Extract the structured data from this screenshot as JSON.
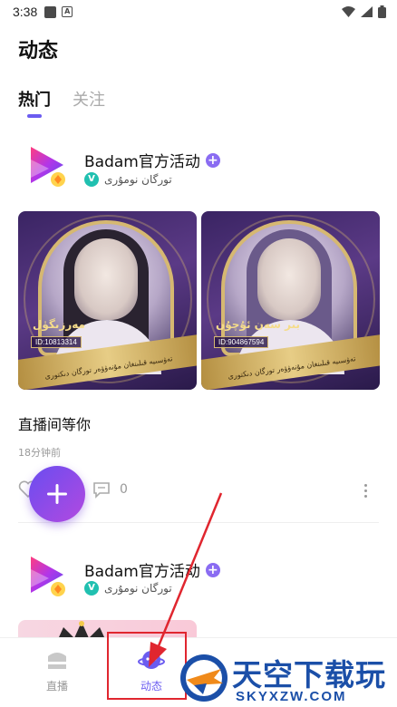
{
  "status_bar": {
    "time": "3:38"
  },
  "header": {
    "title": "动态"
  },
  "tabs": [
    {
      "label": "热门",
      "active": true
    },
    {
      "label": "关注",
      "active": false
    }
  ],
  "posts": [
    {
      "author": "Badam官方活动",
      "subtitle": "تورگان نومۇرى",
      "images": [
        {
          "name_text": "مەرزىگۈل",
          "id_text": "ID:10813314",
          "ribbon_text": "تەۋسىيە قىلىنغان مۇنەۋۋەر تورگان دىكتورى"
        },
        {
          "name_text": "بىر سەن ئۇچۇن",
          "id_text": "ID:904867594",
          "ribbon_text": "تەۋسىيە قىلىنغان مۇنەۋۋەر تورگان دىكتورى"
        }
      ],
      "text": "直播间等你",
      "time": "18分钟前",
      "comment_count": "0"
    },
    {
      "author": "Badam官方活动",
      "subtitle": "تورگان نومۇرى"
    }
  ],
  "bottom_nav": [
    {
      "label": "直播",
      "active": false
    },
    {
      "label": "动态",
      "active": true
    }
  ],
  "watermark": {
    "main": "天空下载玩",
    "sub": "SKYXZW.COM"
  },
  "colors": {
    "accent": "#6b5cf0",
    "highlight": "#e0262f"
  }
}
